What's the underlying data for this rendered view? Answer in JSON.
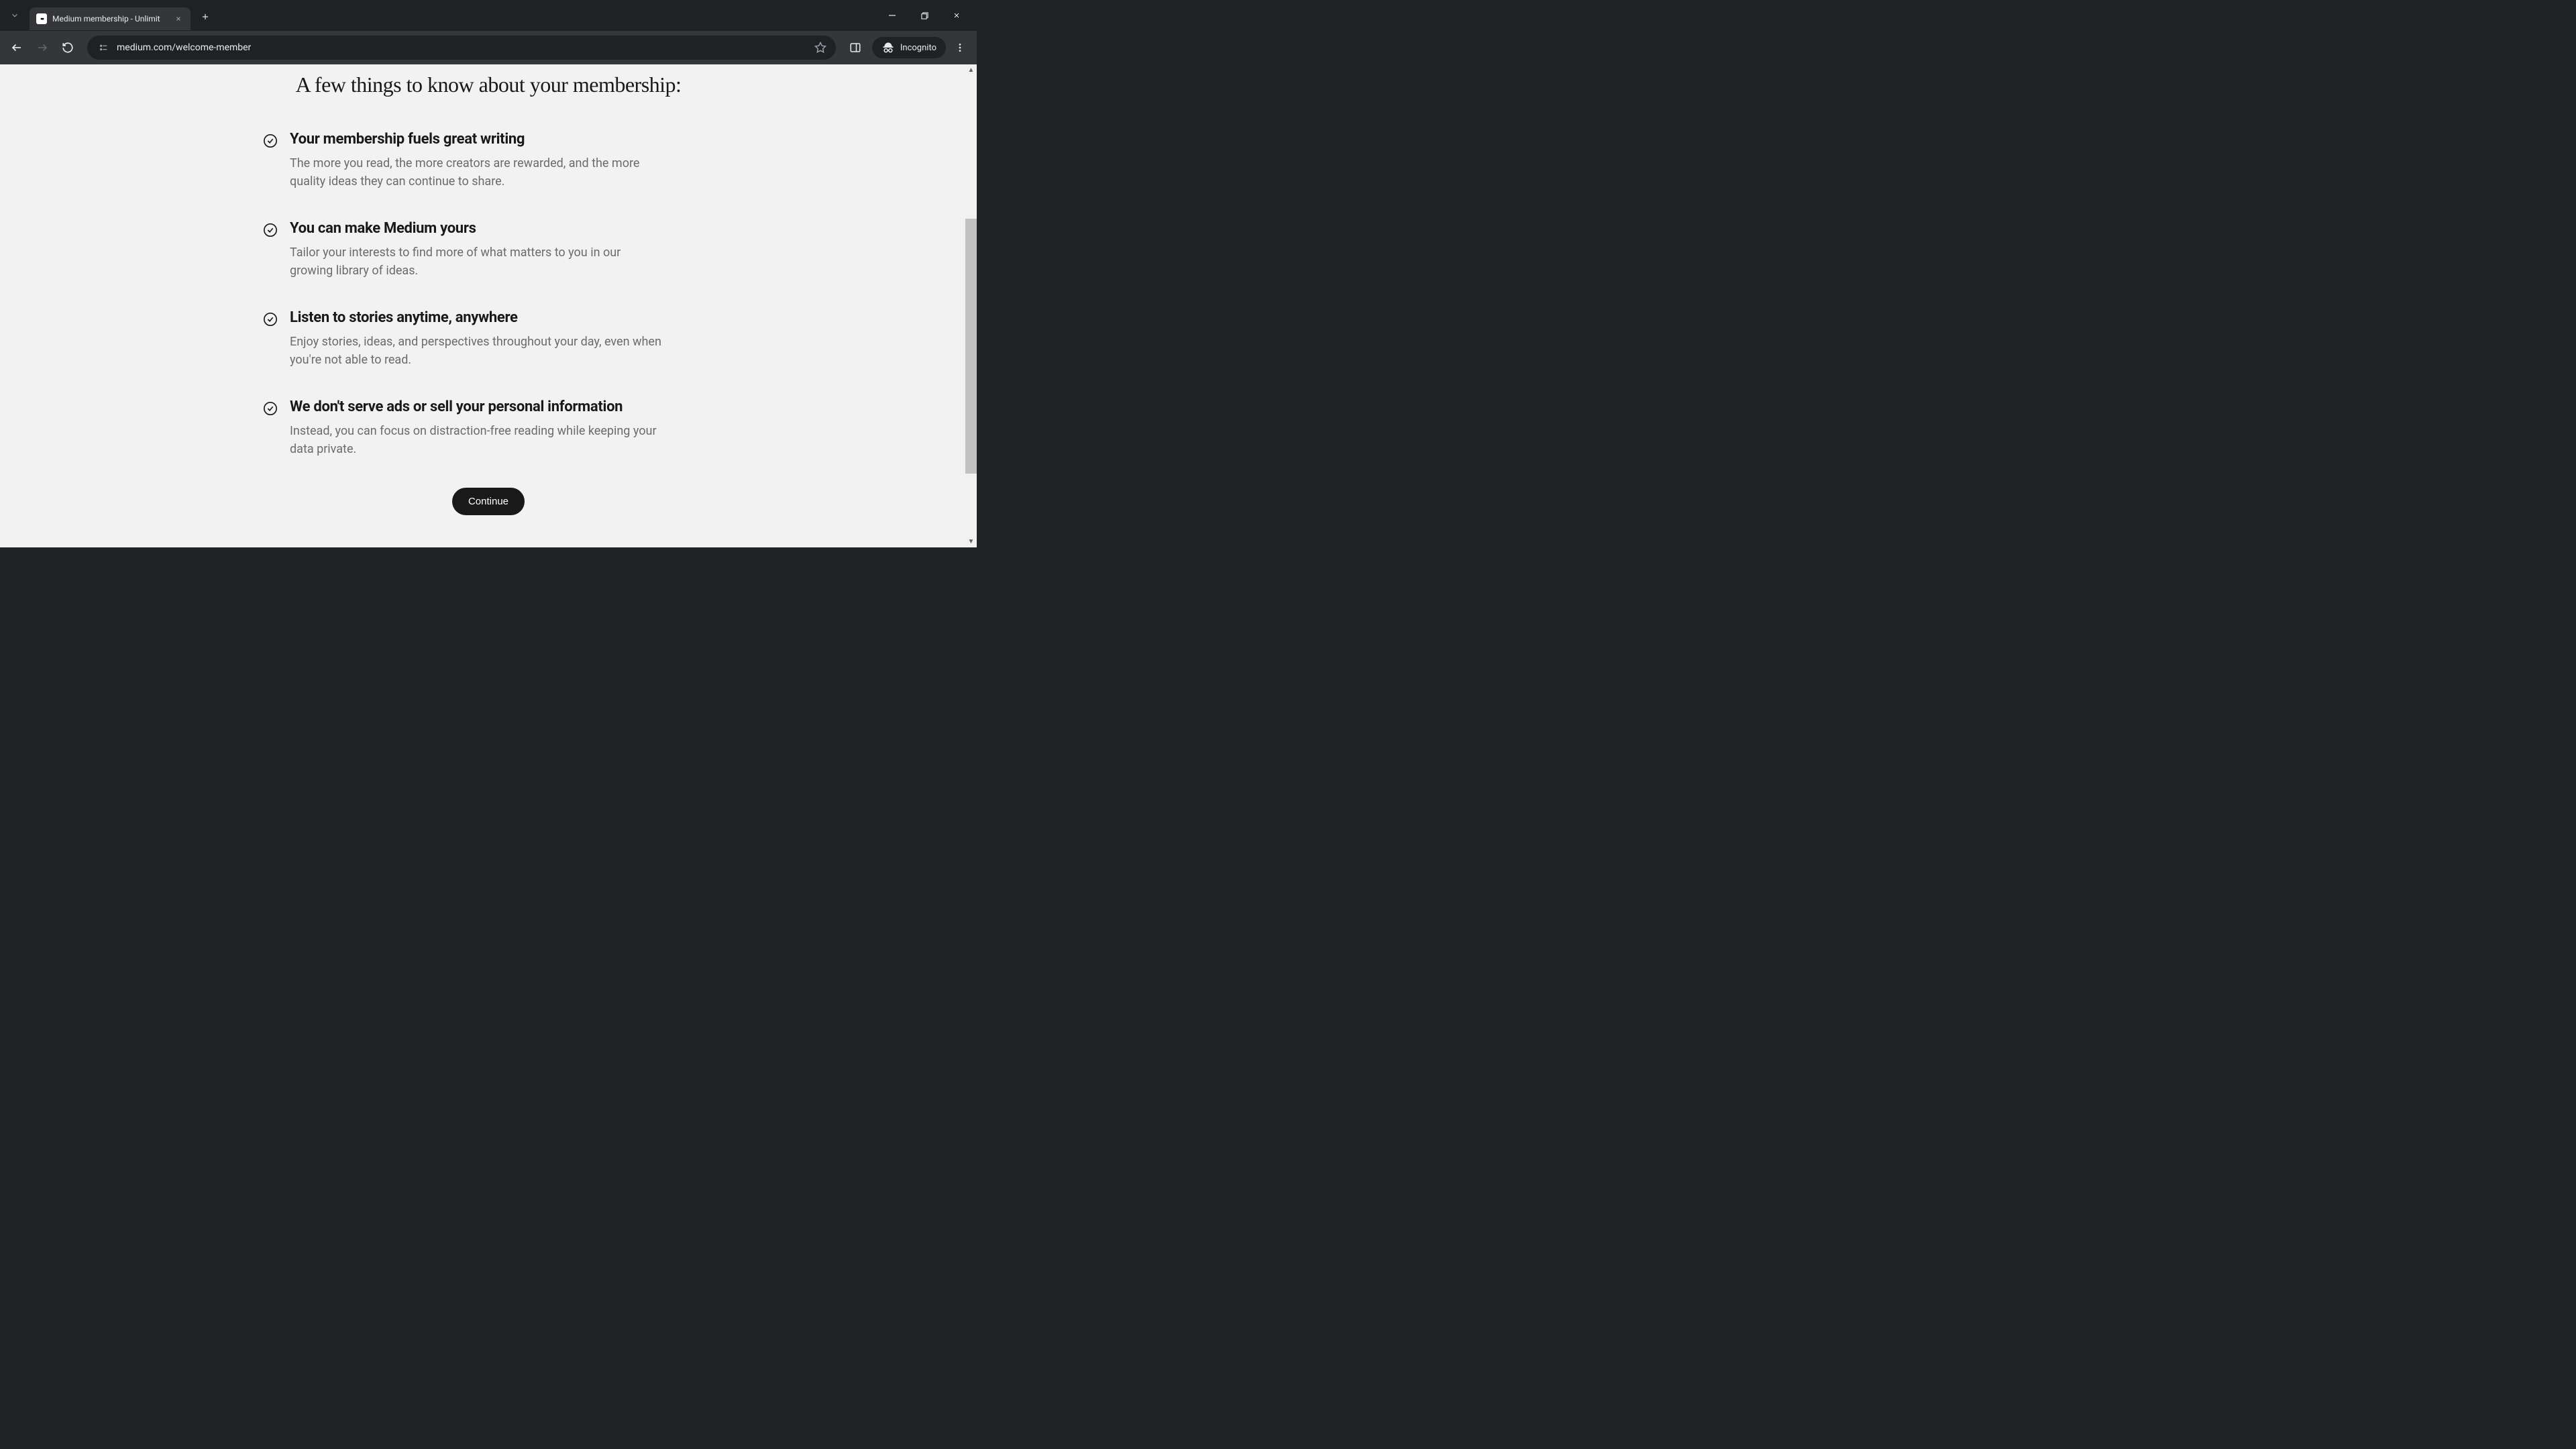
{
  "browser": {
    "tab_title": "Medium membership - Unlimit",
    "url": "medium.com/welcome-member",
    "incognito_label": "Incognito"
  },
  "page": {
    "heading": "A few things to know about your membership:",
    "items": [
      {
        "title": "Your membership fuels great writing",
        "description": "The more you read, the more creators are rewarded, and the more quality ideas they can continue to share."
      },
      {
        "title": "You can make Medium yours",
        "description": "Tailor your interests to find more of what matters to you in our growing library of ideas."
      },
      {
        "title": "Listen to stories anytime, anywhere",
        "description": "Enjoy stories, ideas, and perspectives throughout your day, even when you're not able to read."
      },
      {
        "title": "We don't serve ads or sell your personal information",
        "description": "Instead, you can focus on distraction-free reading while keeping your data private."
      }
    ],
    "continue_label": "Continue"
  }
}
